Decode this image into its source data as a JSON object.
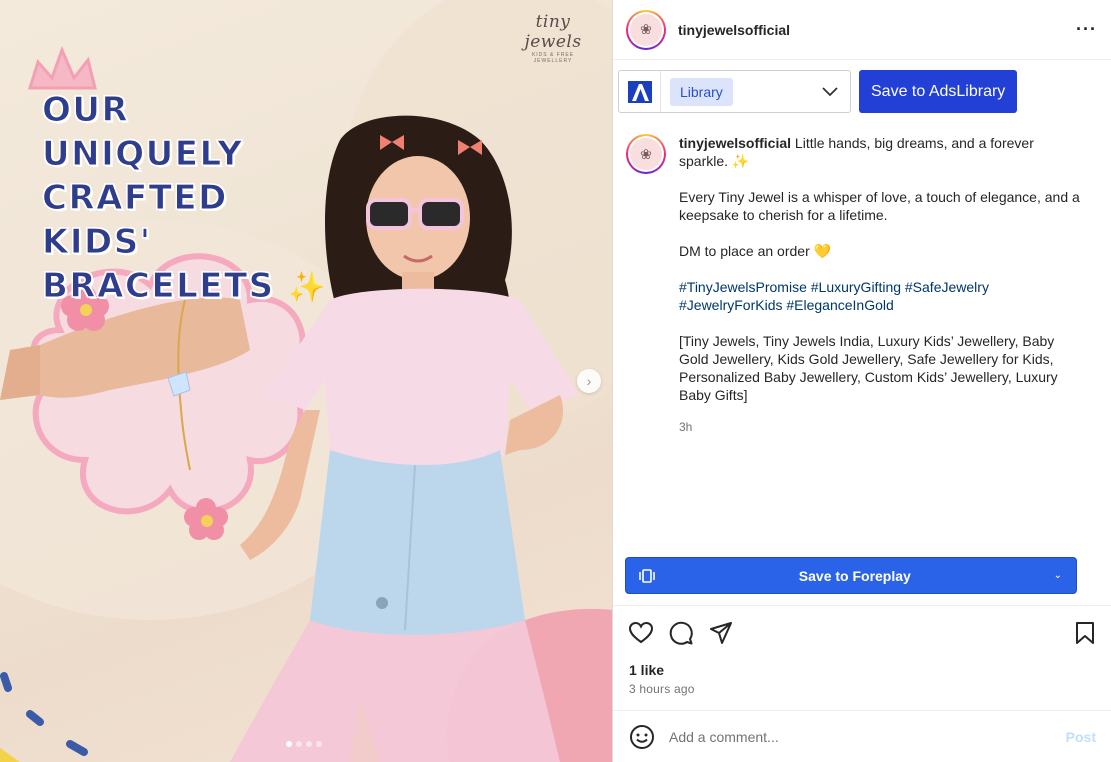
{
  "post": {
    "username": "tinyjewelsofficial",
    "more_icon": "ellipsis-icon"
  },
  "media": {
    "brand_name": "tiny jewels",
    "brand_sub": "KIDS & FREE JEWELLERY",
    "headline": "OUR UNIQUELY CRAFTED KIDS' BRACELETS",
    "headline_sparkle": "✨",
    "next_icon": "chevron-right-icon",
    "slide_count": 4,
    "active_slide": 1
  },
  "ads_library": {
    "selected": "Library",
    "save_label": "Save to AdsLibrary"
  },
  "caption": {
    "username": "tinyjewelsofficial",
    "line1": " Little hands, big dreams, and a forever sparkle. ✨",
    "para2": "Every Tiny Jewel is a whisper of love, a touch of elegance, and a keepsake to cherish for a lifetime.",
    "para3": "DM to place an order 💛",
    "hashtags": "#TinyJewelsPromise #LuxuryGifting #SafeJewelry #JewelryForKids #EleganceInGold",
    "keywords": "[Tiny Jewels, Tiny Jewels India, Luxury Kids’ Jewellery, Baby Gold Jewellery, Kids Gold Jewellery, Safe Jewellery for Kids, Personalized Baby Jewellery, Custom Kids’ Jewellery, Luxury Baby Gifts]",
    "time": "3h"
  },
  "foreplay": {
    "label": "Save to Foreplay"
  },
  "engagement": {
    "likes": "1 like",
    "posted": "3 hours ago"
  },
  "comment": {
    "placeholder": "Add a comment...",
    "post_label": "Post"
  }
}
